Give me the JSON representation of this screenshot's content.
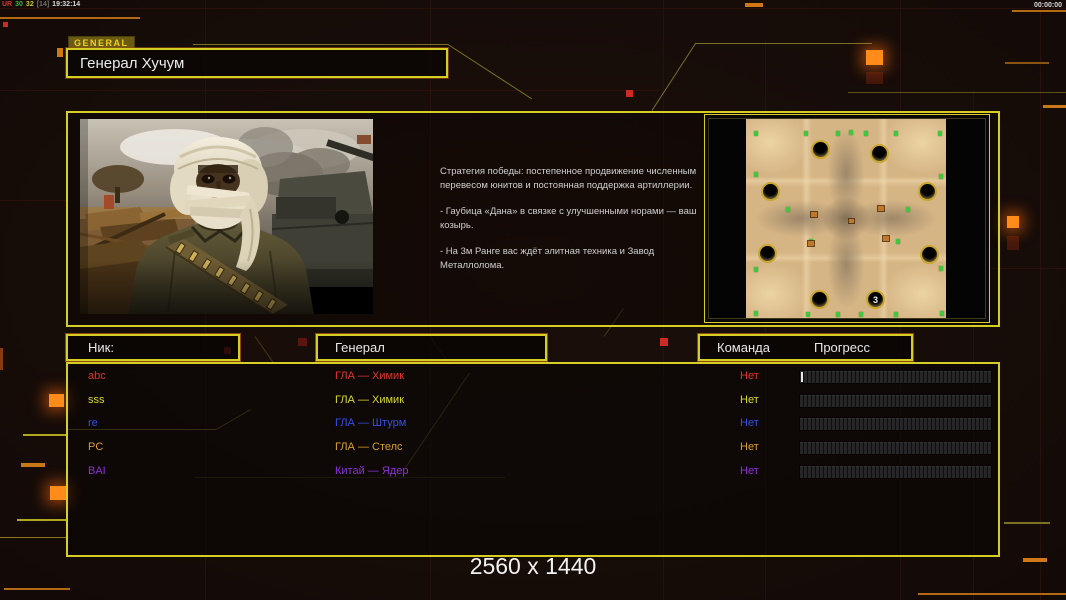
{
  "hud": {
    "stats": [
      {
        "text": "UR",
        "color": "#cc3a2e"
      },
      {
        "text": "30",
        "color": "#3cb848"
      },
      {
        "text": "32",
        "color": "#c8c832"
      },
      {
        "text": "[14]",
        "color": "#6e6e6e"
      },
      {
        "text": "19:32:14",
        "color": "#d8d8d8"
      }
    ],
    "timer": "00:00:00"
  },
  "header": {
    "tag": "GENERAL",
    "title": "Генерал Хучум"
  },
  "briefing": {
    "paragraphs": [
      "Стратегия победы: постепенное продвижение численным перевесом юнитов и постоянная поддержка артиллерии.",
      "- Гаубица «Дана» в связке с улучшенными норами — ваш козырь.",
      "- На 3м Ранге вас ждёт элитная техника и Завод Металлолома."
    ]
  },
  "map_preview": {
    "start_badge": "3"
  },
  "table": {
    "headers": {
      "nick": "Ник:",
      "general": "Генерал",
      "team": "Команда",
      "progress": "Прогресс"
    },
    "rows": [
      {
        "nick": "abc",
        "general": "ГЛА — Химик",
        "team": "Нет",
        "color": "#e0342a",
        "progress_pct": 1
      },
      {
        "nick": "sss",
        "general": "ГЛА — Химик",
        "team": "Нет",
        "color": "#d8d832",
        "progress_pct": 0
      },
      {
        "nick": "re",
        "general": "ГЛА — Штурм",
        "team": "Нет",
        "color": "#3850e0",
        "progress_pct": 0
      },
      {
        "nick": "PC",
        "general": "ГЛА — Стелс",
        "team": "Нет",
        "color": "#dc9e30",
        "progress_pct": 0
      },
      {
        "nick": "BAI",
        "general": "Китай — Ядер",
        "team": "Нет",
        "color": "#8c30d8",
        "progress_pct": 0
      }
    ]
  },
  "footer": {
    "resolution": "2560 x 1440"
  },
  "theme": {
    "accent_yellow": "#d6ce25",
    "accent_orange": "#e07818"
  }
}
